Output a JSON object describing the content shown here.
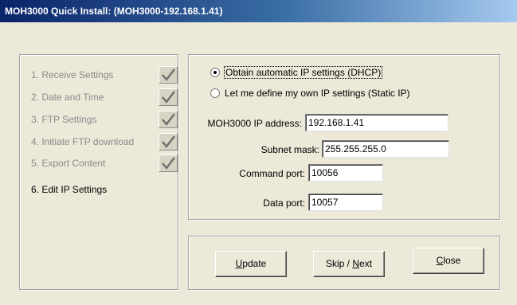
{
  "window": {
    "title": "MOH3000 Quick Install: (MOH3000-192.168.1.41)"
  },
  "steps": [
    {
      "label": "1. Receive Settings",
      "completed": true
    },
    {
      "label": "2. Date and Time",
      "completed": true
    },
    {
      "label": "3. FTP Settings",
      "completed": true
    },
    {
      "label": "4. Initiate FTP download",
      "completed": true
    },
    {
      "label": "5. Export Content",
      "completed": true
    },
    {
      "label": "6. Edit IP Settings",
      "completed": false
    }
  ],
  "ip_settings": {
    "radio_dhcp_label": "Obtain automatic IP settings (DHCP)",
    "radio_dhcp_selected": true,
    "radio_static_label": "Let me define my own IP settings (Static IP)",
    "radio_static_selected": false,
    "ip_address_label": "MOH3000 IP address:",
    "ip_address_value": "192.168.1.41",
    "subnet_mask_label": "Subnet mask:",
    "subnet_mask_value": "255.255.255.0",
    "command_port_label": "Command port:",
    "command_port_value": "10056",
    "data_port_label": "Data port:",
    "data_port_value": "10057"
  },
  "buttons": {
    "update_prefix": "",
    "update_mnemonic": "U",
    "update_rest": "pdate",
    "skip_prefix": "Skip / ",
    "skip_mnemonic": "N",
    "skip_rest": "ext",
    "close_prefix": "",
    "close_mnemonic": "C",
    "close_rest": "lose"
  },
  "colors": {
    "title_bar_start": "#0a246a",
    "title_bar_end": "#a6caf0",
    "dialog_background": "#ece9d8",
    "disabled_text": "#8a8a8a"
  }
}
